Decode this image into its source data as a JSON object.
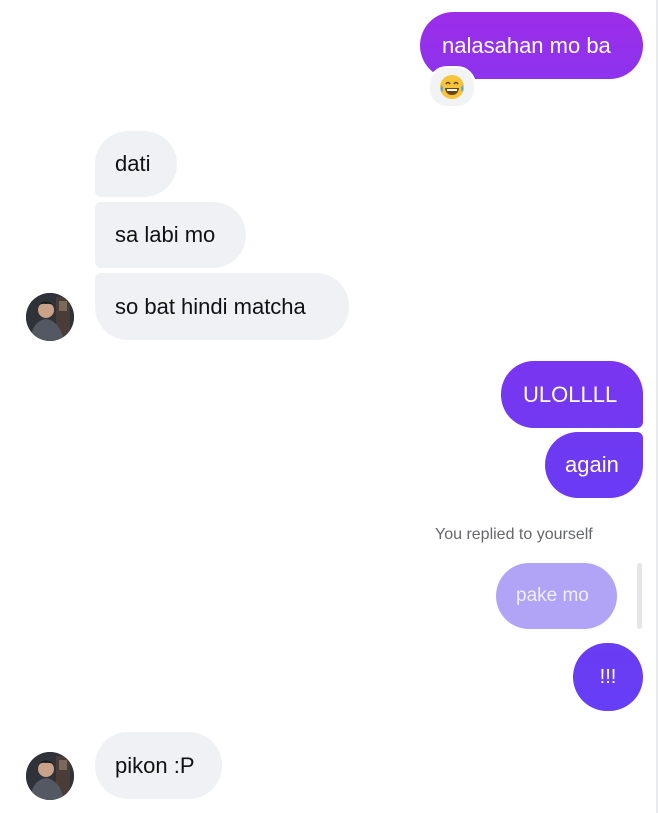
{
  "colors": {
    "incoming_bg": "#eff1f4",
    "outgoing_grad_top": "#9a2ee6",
    "outgoing_grad_bottom": "#6c3cf4",
    "reply_quote_bg": "#b2a4f6",
    "meta_text": "#65676b"
  },
  "messages": [
    {
      "id": "m1",
      "direction": "outgoing",
      "text": "nalasahan mo ba",
      "reaction": "joy-tears-emoji"
    },
    {
      "id": "m2",
      "direction": "incoming",
      "text": "dati"
    },
    {
      "id": "m3",
      "direction": "incoming",
      "text": "sa labi mo"
    },
    {
      "id": "m4",
      "direction": "incoming",
      "text": "so bat hindi matcha",
      "avatar": "contact-avatar"
    },
    {
      "id": "m5",
      "direction": "outgoing",
      "text": "ULOLLLL"
    },
    {
      "id": "m6",
      "direction": "outgoing",
      "text": "again"
    },
    {
      "id": "m7",
      "direction": "outgoing",
      "reply_label": "You replied to yourself",
      "quoted_text": "pake mo",
      "text": "!!!"
    },
    {
      "id": "m8",
      "direction": "incoming",
      "text": "pikon :P",
      "avatar": "contact-avatar"
    }
  ]
}
